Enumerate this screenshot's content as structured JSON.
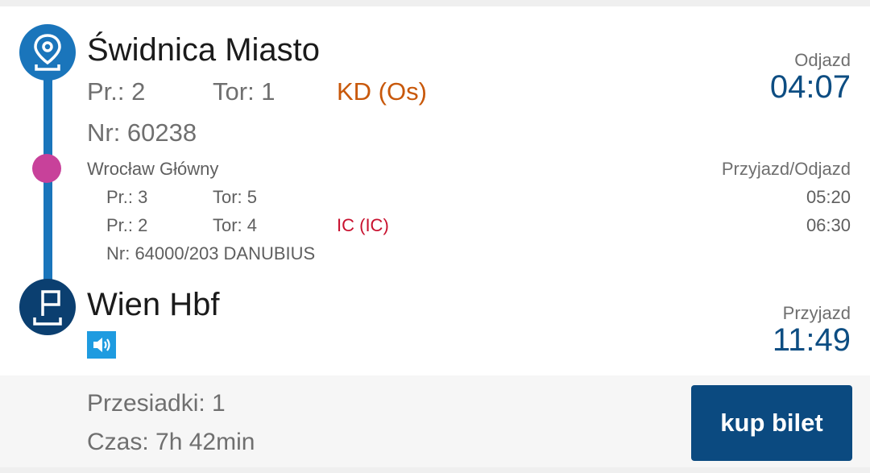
{
  "origin": {
    "name": "Świdnica Miasto",
    "platform": "Pr.: 2",
    "track": "Tor: 1",
    "carrier": "KD (Os)",
    "train_number": "Nr: 60238",
    "time_label": "Odjazd",
    "time": "04:07"
  },
  "via": {
    "name": "Wrocław Główny",
    "time_label": "Przyjazd/Odjazd",
    "arrival": {
      "platform": "Pr.: 3",
      "track": "Tor: 5",
      "time": "05:20"
    },
    "departure": {
      "platform": "Pr.: 2",
      "track": "Tor: 4",
      "carrier": "IC (IC)",
      "time": "06:30"
    },
    "train_number": "Nr: 64000/203 DANUBIUS"
  },
  "destination": {
    "name": "Wien Hbf",
    "time_label": "Przyjazd",
    "time": "11:49"
  },
  "footer": {
    "transfers": "Przesiadki: 1",
    "duration": "Czas: 7h 42min",
    "buy_label": "kup bilet"
  },
  "icons": {
    "origin": "map-pin-icon",
    "destination": "flag-pin-icon",
    "via": "via-dot-icon",
    "audio": "speaker-icon"
  },
  "colors": {
    "primary": "#1a75bb",
    "dark": "#0b4a80",
    "via_dot": "#c8419a",
    "carrier_kd": "#c8580a",
    "carrier_ic": "#c8102e"
  }
}
